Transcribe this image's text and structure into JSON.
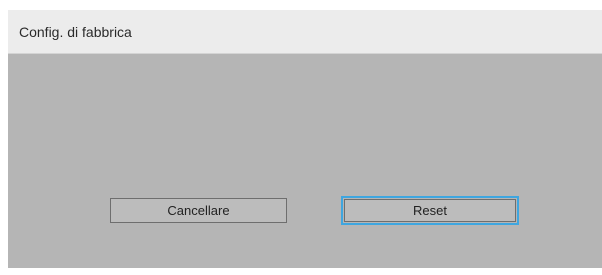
{
  "dialog": {
    "title": "Config. di fabbrica",
    "buttons": {
      "cancel_label": "Cancellare",
      "reset_label": "Reset"
    },
    "focused_button": "reset"
  },
  "colors": {
    "background": "#b5b5b5",
    "title_bar": "#ececec",
    "focus_outline": "#3ea6e0"
  }
}
